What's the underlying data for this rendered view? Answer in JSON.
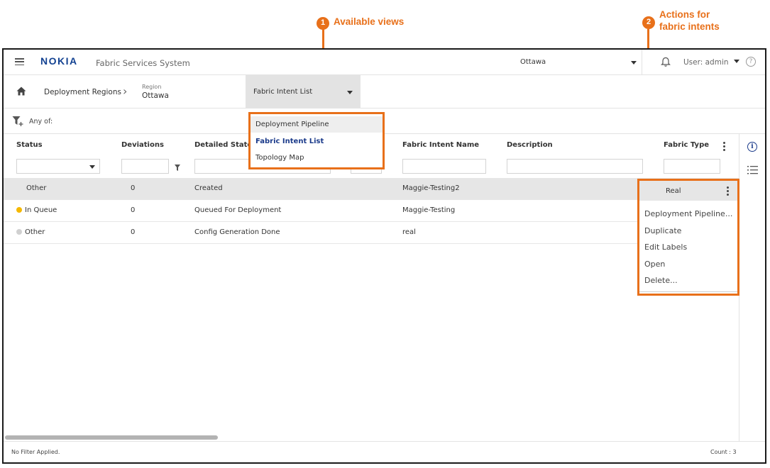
{
  "annotations": {
    "callout1": {
      "number": "1",
      "label": "Available views"
    },
    "callout2": {
      "number": "2",
      "label_line1": "Actions for",
      "label_line2": "fabric intents"
    },
    "accent_color": "#e8701a"
  },
  "topbar": {
    "brand": "NOKIA",
    "app_title": "Fabric Services System",
    "region": "Ottawa",
    "user": "User: admin",
    "help": "?"
  },
  "breadcrumb": {
    "root": "Deployment Regions",
    "region_label": "Region",
    "region_value": "Ottawa"
  },
  "view_selector": {
    "selected": "Fabric Intent List",
    "options": [
      "Deployment Pipeline",
      "Fabric Intent List",
      "Topology Map"
    ]
  },
  "filter": {
    "text": "Any of:"
  },
  "table": {
    "headers": {
      "status": "Status",
      "deviations": "Deviations",
      "detailed_state": "Detailed State",
      "name": "Fabric Intent Name",
      "description": "Description",
      "fabric_type": "Fabric Type"
    },
    "rows": [
      {
        "status": "Other",
        "status_dot": "",
        "deviations": "0",
        "detailed_state": "Created",
        "name": "Maggie-Testing2",
        "fabric_type": "Real"
      },
      {
        "status": "In Queue",
        "status_dot": "#f5b800",
        "deviations": "0",
        "detailed_state": "Queued For Deployment",
        "name": "Maggie-Testing",
        "fabric_type": ""
      },
      {
        "status": "Other",
        "status_dot": "#d0d0d0",
        "deviations": "0",
        "detailed_state": "Config Generation Done",
        "name": "real",
        "fabric_type": ""
      }
    ]
  },
  "row_actions": {
    "items": [
      "Deployment Pipeline...",
      "Duplicate",
      "Edit Labels",
      "Open",
      "Delete..."
    ]
  },
  "footer": {
    "filter_status": "No Filter Applied.",
    "count": "Count : 3"
  },
  "colors": {
    "accent": "#e8701a",
    "brand": "#1a3a8a",
    "selected_row": "#e6e6e6"
  }
}
